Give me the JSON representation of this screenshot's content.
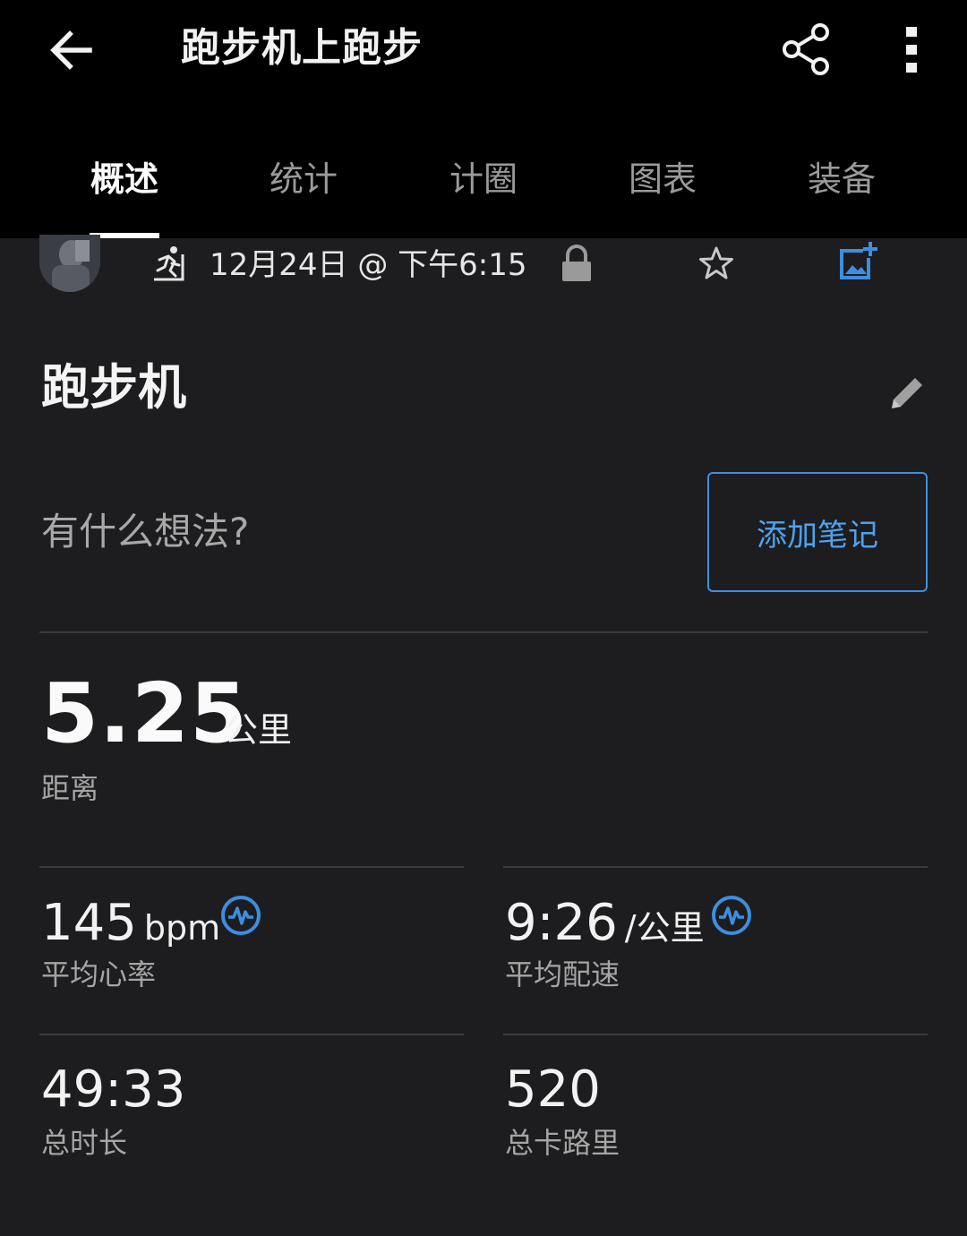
{
  "header": {
    "title": "跑步机上跑步",
    "back_icon": "arrow-left-icon",
    "share_icon": "share-icon",
    "more_icon": "more-vertical-icon"
  },
  "tabs": [
    {
      "label": "概述",
      "active": true
    },
    {
      "label": "统计",
      "active": false
    },
    {
      "label": "计圈",
      "active": false
    },
    {
      "label": "图表",
      "active": false
    },
    {
      "label": "装备",
      "active": false
    }
  ],
  "meta": {
    "datetime": "12月24日 @ 下午6:15",
    "activity_icon": "treadmill-run-icon",
    "privacy_icon": "lock-icon",
    "favorite_icon": "star-outline-icon",
    "photo_icon": "add-photo-icon"
  },
  "activity": {
    "name": "跑步机",
    "edit_icon": "pencil-icon"
  },
  "notes": {
    "prompt": "有什么想法?",
    "button_label": "添加笔记"
  },
  "distance": {
    "value": "5.25",
    "unit": "公里",
    "label": "距离"
  },
  "stats": [
    {
      "value": "145",
      "unit": "bpm",
      "label": "平均心率",
      "badge": "heart-rate-sensor-icon"
    },
    {
      "value": "9:26",
      "unit": "/公里",
      "label": "平均配速",
      "badge": "heart-rate-sensor-icon"
    },
    {
      "value": "49:33",
      "unit": "",
      "label": "总时长"
    },
    {
      "value": "520",
      "unit": "",
      "label": "总卡路里"
    }
  ],
  "colors": {
    "background": "#1d1d1f",
    "appbar": "#000000",
    "accent": "#3c8fe0",
    "divider": "#3b3b3d"
  }
}
